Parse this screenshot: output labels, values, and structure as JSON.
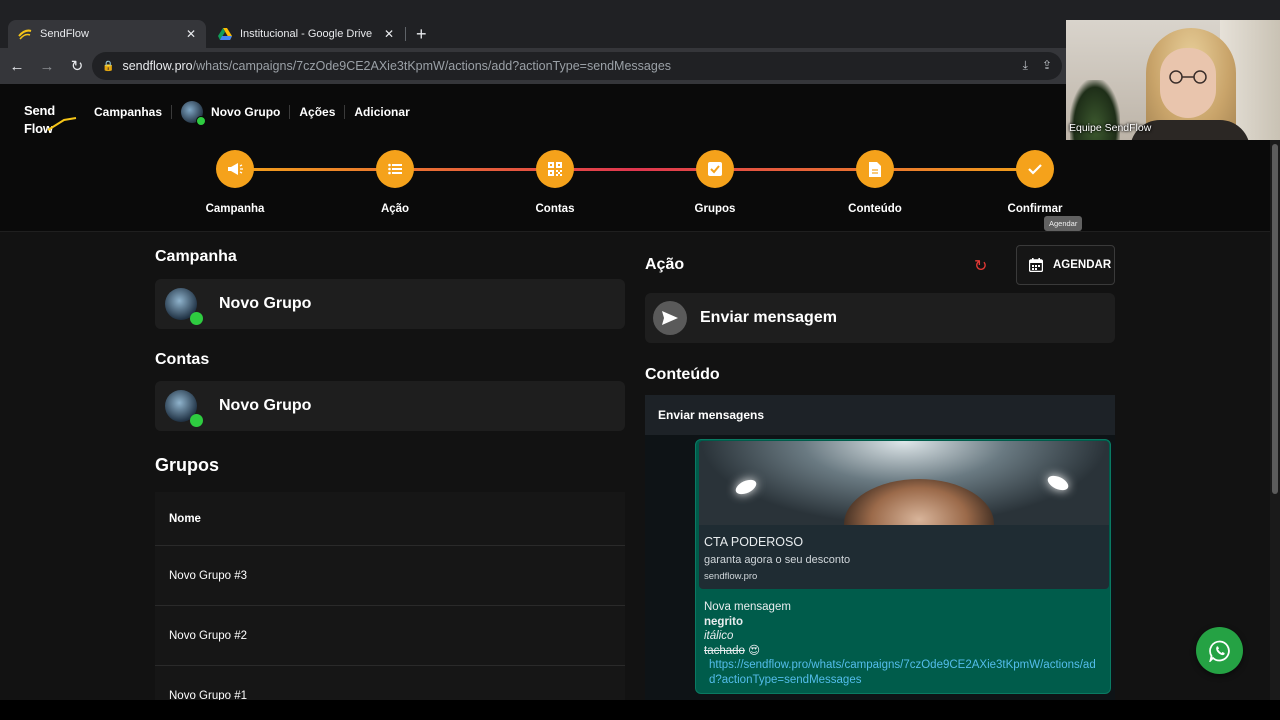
{
  "browser": {
    "tabs": [
      {
        "title": "SendFlow",
        "active": true,
        "icon": "sendflow-favicon"
      },
      {
        "title": "Institucional - Google Drive",
        "active": false,
        "icon": "google-drive-favicon"
      }
    ],
    "new_tab": "+",
    "url_host": "sendflow.pro",
    "url_path": "/whats/campaigns/7czOde9CE2AXie3tKpmW/actions/add?actionType=sendMessages"
  },
  "app": {
    "logo_text": "Send Flow",
    "breadcrumb": [
      "Campanhas",
      "Novo Grupo",
      "Ações",
      "Adicionar"
    ],
    "steps": [
      "Campanha",
      "Ação",
      "Contas",
      "Grupos",
      "Conteúdo",
      "Confirmar"
    ],
    "tooltip": "Agendar",
    "campanha": {
      "title": "Campanha",
      "name": "Novo Grupo"
    },
    "contas": {
      "title": "Contas",
      "name": "Novo Grupo"
    },
    "grupos": {
      "title": "Grupos",
      "column": "Nome",
      "rows": [
        "Novo Grupo #3",
        "Novo Grupo #2",
        "Novo Grupo #1"
      ]
    },
    "acao": {
      "title": "Ação",
      "agendar": "AGENDAR",
      "action_name": "Enviar mensagem"
    },
    "conteudo": {
      "title": "Conteúdo",
      "header": "Enviar mensagens",
      "preview_title": "CTA PODEROSO",
      "preview_desc": "garanta agora o seu desconto",
      "preview_site": "sendflow.pro",
      "msg_line1": "Nova mensagem",
      "msg_bold": "negrito",
      "msg_italic": "itálico",
      "msg_strike": "tachado",
      "msg_emoji": "😍",
      "msg_link": "https://sendflow.pro/whats/campaigns/7czOde9CE2AXie3tKpmW/actions/add?actionType=sendMessages"
    }
  },
  "webcam": {
    "name": "Equipe SendFlow"
  },
  "colors": {
    "accent": "#f5a21b",
    "whatsapp_green": "#25a244",
    "bubble": "#005c4b",
    "refresh": "#e53935"
  }
}
